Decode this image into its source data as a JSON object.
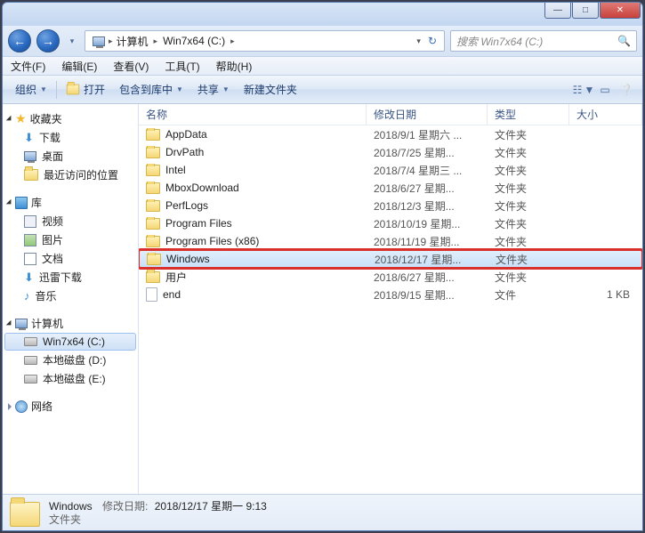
{
  "titlebar": {
    "min": "—",
    "max": "□",
    "close": "✕"
  },
  "nav": {
    "back": "←",
    "fwd": "→",
    "dd": "▾",
    "breadcrumb": [
      {
        "icon": "computer",
        "label": "计算机"
      },
      {
        "icon": "",
        "label": "Win7x64 (C:)"
      }
    ],
    "bc_refresh": "↻",
    "search_placeholder": "搜索 Win7x64 (C:)"
  },
  "menubar": [
    "文件(F)",
    "编辑(E)",
    "查看(V)",
    "工具(T)",
    "帮助(H)"
  ],
  "toolbar": {
    "organize": "组织",
    "open": "打开",
    "include": "包含到库中",
    "share": "共享",
    "newfolder": "新建文件夹"
  },
  "navpane": {
    "favorites": {
      "label": "收藏夹",
      "items": [
        "下载",
        "桌面",
        "最近访问的位置"
      ]
    },
    "libraries": {
      "label": "库",
      "items": [
        "视频",
        "图片",
        "文档",
        "迅雷下载",
        "音乐"
      ]
    },
    "computer": {
      "label": "计算机",
      "items": [
        "Win7x64 (C:)",
        "本地磁盘 (D:)",
        "本地磁盘 (E:)"
      ]
    },
    "network": {
      "label": "网络"
    }
  },
  "columns": {
    "name": "名称",
    "date": "修改日期",
    "type": "类型",
    "size": "大小"
  },
  "files": [
    {
      "icon": "folder",
      "name": "AppData",
      "date": "2018/9/1 星期六 ...",
      "type": "文件夹",
      "size": ""
    },
    {
      "icon": "folder",
      "name": "DrvPath",
      "date": "2018/7/25 星期...",
      "type": "文件夹",
      "size": ""
    },
    {
      "icon": "folder",
      "name": "Intel",
      "date": "2018/7/4 星期三 ...",
      "type": "文件夹",
      "size": ""
    },
    {
      "icon": "folder",
      "name": "MboxDownload",
      "date": "2018/6/27 星期...",
      "type": "文件夹",
      "size": ""
    },
    {
      "icon": "folder",
      "name": "PerfLogs",
      "date": "2018/12/3 星期...",
      "type": "文件夹",
      "size": ""
    },
    {
      "icon": "folder",
      "name": "Program Files",
      "date": "2018/10/19 星期...",
      "type": "文件夹",
      "size": ""
    },
    {
      "icon": "folder",
      "name": "Program Files (x86)",
      "date": "2018/11/19 星期...",
      "type": "文件夹",
      "size": ""
    },
    {
      "icon": "folder",
      "name": "Windows",
      "date": "2018/12/17 星期...",
      "type": "文件夹",
      "size": "",
      "selected": true,
      "marked": true
    },
    {
      "icon": "folder",
      "name": "用户",
      "date": "2018/6/27 星期...",
      "type": "文件夹",
      "size": ""
    },
    {
      "icon": "file",
      "name": "end",
      "date": "2018/9/15 星期...",
      "type": "文件",
      "size": "1 KB"
    }
  ],
  "details": {
    "name": "Windows",
    "date_label": "修改日期:",
    "date": "2018/12/17 星期一 9:13",
    "type": "文件夹"
  }
}
